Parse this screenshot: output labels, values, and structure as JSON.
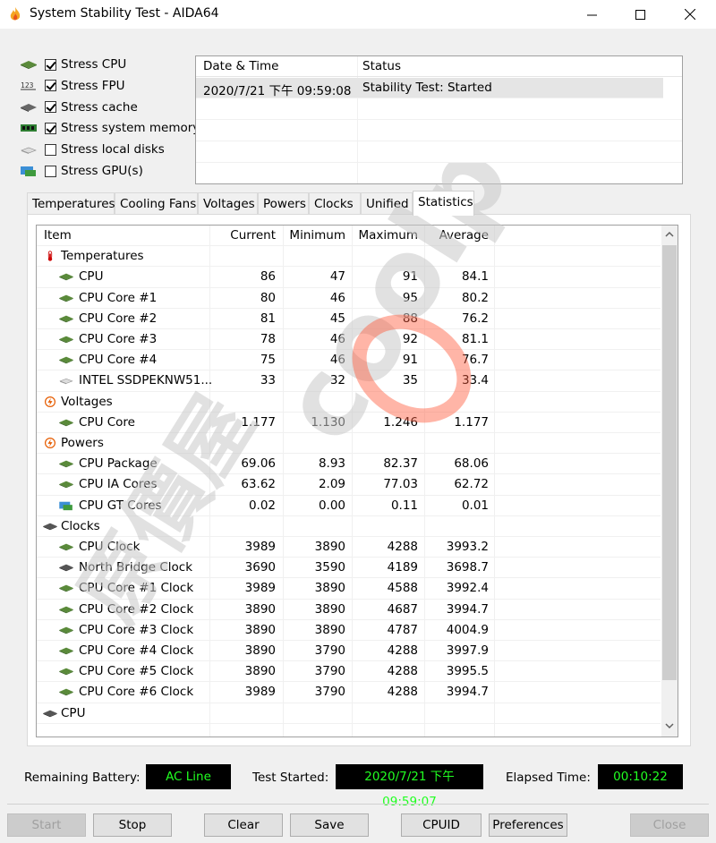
{
  "window": {
    "title": "System Stability Test - AIDA64"
  },
  "stress_options": [
    {
      "label": "Stress CPU",
      "checked": true,
      "icon": "cpu-chip-icon"
    },
    {
      "label": "Stress FPU",
      "checked": true,
      "icon": "fpu-123-icon"
    },
    {
      "label": "Stress cache",
      "checked": true,
      "icon": "cache-chip-icon"
    },
    {
      "label": "Stress system memory",
      "checked": true,
      "icon": "memory-module-icon"
    },
    {
      "label": "Stress local disks",
      "checked": false,
      "icon": "disk-drive-icon"
    },
    {
      "label": "Stress GPU(s)",
      "checked": false,
      "icon": "gpu-card-icon"
    }
  ],
  "log": {
    "headers": [
      "Date & Time",
      "Status"
    ],
    "rows": [
      {
        "datetime": "2020/7/21 下午 09:59:08",
        "status": "Stability Test: Started"
      }
    ]
  },
  "tabs": [
    "Temperatures",
    "Cooling Fans",
    "Voltages",
    "Powers",
    "Clocks",
    "Unified",
    "Statistics"
  ],
  "active_tab": "Statistics",
  "stats": {
    "headers": [
      "Item",
      "Current",
      "Minimum",
      "Maximum",
      "Average"
    ],
    "rows": [
      {
        "type": "group",
        "icon": "thermometer-icon",
        "item": "Temperatures"
      },
      {
        "type": "row",
        "icon": "cpu-chip-icon",
        "item": "CPU",
        "current": "86",
        "min": "47",
        "max": "91",
        "avg": "84.1"
      },
      {
        "type": "row",
        "icon": "cpu-chip-icon",
        "item": "CPU Core #1",
        "current": "80",
        "min": "46",
        "max": "95",
        "avg": "80.2"
      },
      {
        "type": "row",
        "icon": "cpu-chip-icon",
        "item": "CPU Core #2",
        "current": "81",
        "min": "45",
        "max": "88",
        "avg": "76.2"
      },
      {
        "type": "row",
        "icon": "cpu-chip-icon",
        "item": "CPU Core #3",
        "current": "78",
        "min": "46",
        "max": "92",
        "avg": "81.1"
      },
      {
        "type": "row",
        "icon": "cpu-chip-icon",
        "item": "CPU Core #4",
        "current": "75",
        "min": "46",
        "max": "91",
        "avg": "76.7"
      },
      {
        "type": "row",
        "icon": "disk-drive-icon",
        "item": "INTEL SSDPEKNW51...",
        "current": "33",
        "min": "32",
        "max": "35",
        "avg": "33.4"
      },
      {
        "type": "group",
        "icon": "lightning-icon",
        "item": "Voltages"
      },
      {
        "type": "row",
        "icon": "cpu-chip-icon",
        "item": "CPU Core",
        "current": "1.177",
        "min": "1.130",
        "max": "1.246",
        "avg": "1.177"
      },
      {
        "type": "group",
        "icon": "lightning-icon",
        "item": "Powers"
      },
      {
        "type": "row",
        "icon": "cpu-chip-icon",
        "item": "CPU Package",
        "current": "69.06",
        "min": "8.93",
        "max": "82.37",
        "avg": "68.06"
      },
      {
        "type": "row",
        "icon": "cpu-chip-icon",
        "item": "CPU IA Cores",
        "current": "63.62",
        "min": "2.09",
        "max": "77.03",
        "avg": "62.72"
      },
      {
        "type": "row",
        "icon": "gpu-card-icon",
        "item": "CPU GT Cores",
        "current": "0.02",
        "min": "0.00",
        "max": "0.11",
        "avg": "0.01"
      },
      {
        "type": "group",
        "icon": "chip-icon",
        "item": "Clocks"
      },
      {
        "type": "row",
        "icon": "cpu-chip-icon",
        "item": "CPU Clock",
        "current": "3989",
        "min": "3890",
        "max": "4288",
        "avg": "3993.2"
      },
      {
        "type": "row",
        "icon": "chip-icon",
        "item": "North Bridge Clock",
        "current": "3690",
        "min": "3590",
        "max": "4189",
        "avg": "3698.7"
      },
      {
        "type": "row",
        "icon": "cpu-chip-icon",
        "item": "CPU Core #1 Clock",
        "current": "3989",
        "min": "3890",
        "max": "4588",
        "avg": "3992.4"
      },
      {
        "type": "row",
        "icon": "cpu-chip-icon",
        "item": "CPU Core #2 Clock",
        "current": "3890",
        "min": "3890",
        "max": "4687",
        "avg": "3994.7"
      },
      {
        "type": "row",
        "icon": "cpu-chip-icon",
        "item": "CPU Core #3 Clock",
        "current": "3890",
        "min": "3890",
        "max": "4787",
        "avg": "4004.9"
      },
      {
        "type": "row",
        "icon": "cpu-chip-icon",
        "item": "CPU Core #4 Clock",
        "current": "3890",
        "min": "3790",
        "max": "4288",
        "avg": "3997.9"
      },
      {
        "type": "row",
        "icon": "cpu-chip-icon",
        "item": "CPU Core #5 Clock",
        "current": "3890",
        "min": "3790",
        "max": "4288",
        "avg": "3995.5"
      },
      {
        "type": "row",
        "icon": "cpu-chip-icon",
        "item": "CPU Core #6 Clock",
        "current": "3989",
        "min": "3790",
        "max": "4288",
        "avg": "3994.7"
      },
      {
        "type": "group",
        "icon": "chip-icon",
        "item": "CPU"
      }
    ]
  },
  "status": {
    "remaining_battery_label": "Remaining Battery:",
    "remaining_battery_value": "AC Line",
    "test_started_label": "Test Started:",
    "test_started_value": "2020/7/21 下午 09:59:07",
    "elapsed_label": "Elapsed Time:",
    "elapsed_value": "00:10:22"
  },
  "buttons": {
    "start": "Start",
    "stop": "Stop",
    "clear": "Clear",
    "save": "Save",
    "cpuid": "CPUID",
    "preferences": "Preferences",
    "close": "Close"
  },
  "watermark": {
    "text": "原價屋",
    "logo_text": "coolpc"
  },
  "colors": {
    "status_text": "#21ff21",
    "status_bg": "#000000",
    "watermark_accent": "#ff5a3c"
  }
}
